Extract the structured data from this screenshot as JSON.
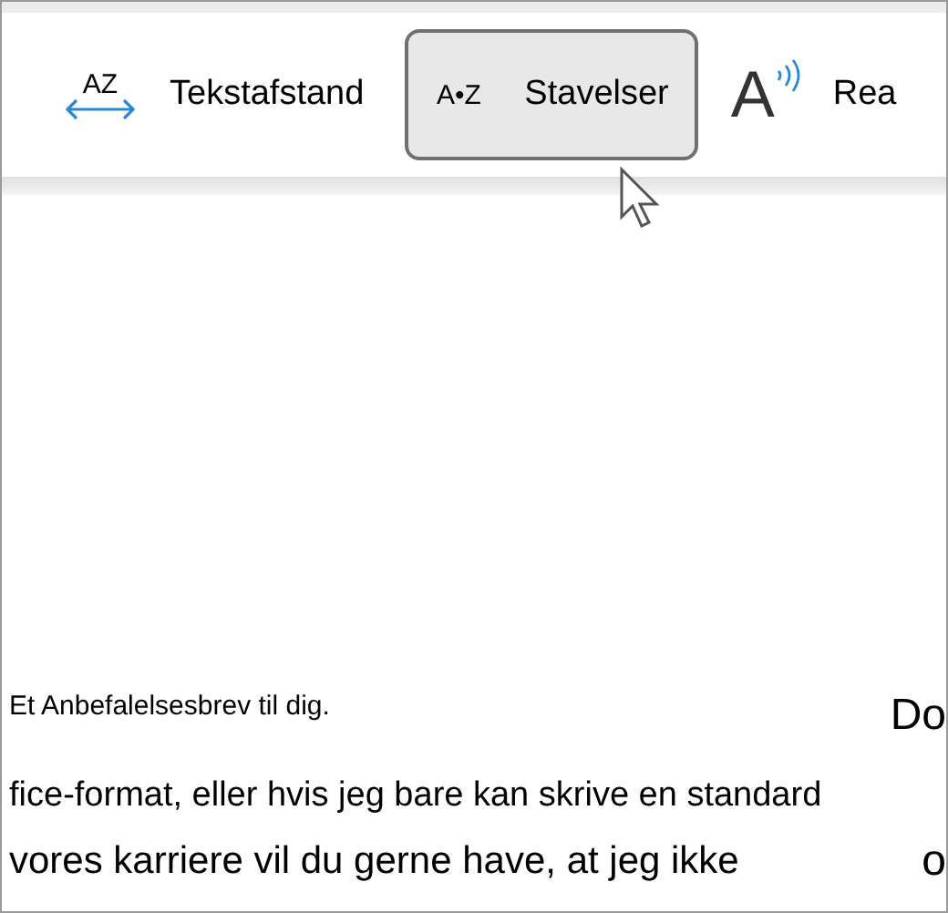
{
  "toolbar": {
    "items": [
      {
        "kind": "spacing",
        "icon_text": "AZ",
        "label": "Tekstafstand",
        "selected": false
      },
      {
        "kind": "syllables",
        "icon_text": "A•Z",
        "label": "Stavelser",
        "selected": true
      },
      {
        "kind": "read",
        "icon_text": "A",
        "label": "Rea",
        "selected": false
      }
    ]
  },
  "document": {
    "heading": "Et Anbefalelsesbrev til dig.",
    "side_top": "Do",
    "lines": [
      "fice-format, eller hvis jeg bare kan skrive en standard",
      "vores karriere vil du gerne have, at jeg ikke"
    ],
    "side_bottom": "o"
  }
}
